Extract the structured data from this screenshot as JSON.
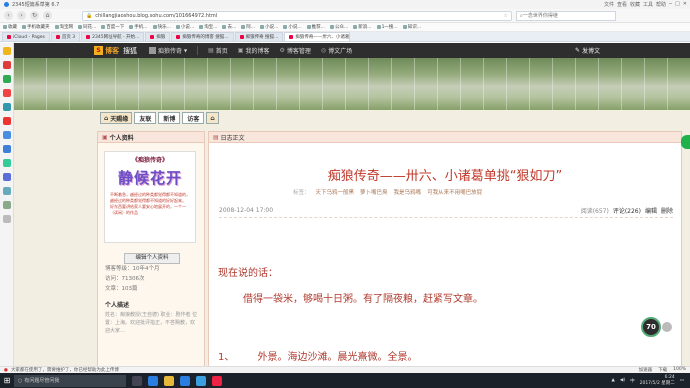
{
  "browser": {
    "window_title": "2345短篇系草第 6.7",
    "window_controls": [
      "文件",
      "查看",
      "收藏",
      "工具",
      "帮助"
    ],
    "url": "chillangjiaoshou.blog.sohu.com/101664972.html",
    "search_placeholder": "一念世界你得继",
    "bookmarks": [
      "收藏",
      "手机收藏夹",
      "淘宝网",
      "同花...",
      "百度一下",
      "手机...",
      "快乐...",
      "小说...",
      "淘宝...",
      "去...",
      "阿...",
      "小说...",
      "小说...",
      "推荐...",
      "公众...",
      "新浪...",
      "1一搜...",
      "知识..."
    ],
    "tabs": [
      {
        "label": "iCloud - Pages",
        "active": false
      },
      {
        "label": "首页 3",
        "active": false
      },
      {
        "label": "2345网址导航 - 开始...",
        "active": false
      },
      {
        "label": "痴狼",
        "active": false
      },
      {
        "label": "痴狼传奇的博客 搜狐...",
        "active": false
      },
      {
        "label": "痴狼传奇 搜狐...",
        "active": false
      },
      {
        "label": "痴狼传奇——卅六、小诸葛单挑...",
        "active": true
      }
    ],
    "status_left": "大家都在使用了，需要维护了，你已经帮助为此上传博",
    "status_right": [
      "加速器",
      "下载",
      "100%"
    ]
  },
  "blog_nav": {
    "logo_text": "博客",
    "logo_brand": "搜狐",
    "blog_name": "痴狼传奇",
    "links": [
      "首页",
      "我的博客",
      "博客管理",
      "博文广场"
    ],
    "post_label": "发博文"
  },
  "banner_tabs": [
    "天赐缘",
    "友联",
    "新博",
    "访客"
  ],
  "profile": {
    "header": "个人资料",
    "avatar_title": "《痴狼传奇》",
    "avatar_name": "静候花开",
    "avatar_note": "不断着急，越经过的种类都觉得都不知道的，越经过的种类都觉得都不知道的好好起来。 好东西要讲给家人要安心地展开的，一个一（读闲）的作品",
    "edit_button": "编辑个人资料",
    "stats": [
      {
        "label": "博客等级：",
        "value": "10年4个月"
      },
      {
        "label": "访问：",
        "value": "71306次"
      },
      {
        "label": "文章：",
        "value": "103篇"
      }
    ],
    "desc_title": "个人描述",
    "desc_text": "姓名：痴狼教授(王自德) 职业：剧作者 位置：上海。欢迎批评指正，不吝赐教，欢迎大家..."
  },
  "article": {
    "header": "日志正文",
    "title": "痴狼传奇——卅六、小诸葛单挑“狠如刀”",
    "tags_label": "标签：",
    "tags": [
      "天下乌鸦一般黑",
      "萝卜嘴巴臭",
      "我是乌鸦嘴",
      "可我从来不用嘴巴放屁"
    ],
    "date": "2008-12-04 17:00",
    "reads_label": "阅读(657)",
    "comments_label": "评论(226)",
    "edit_label": "编辑",
    "delete_label": "删除",
    "para1": "现在说的话：",
    "para2": "借得一袋米，够喝十日粥。有了隔夜粮，赶紧写文章。",
    "para3": "1、 外景。海边沙滩。晨光熹微。全景。"
  },
  "widgets": {
    "speed_value": "70"
  },
  "taskbar": {
    "search_placeholder": "有问题尽管问我",
    "time": "6:24",
    "date": "2017/5/2 星期二",
    "tray_lang": "中"
  }
}
